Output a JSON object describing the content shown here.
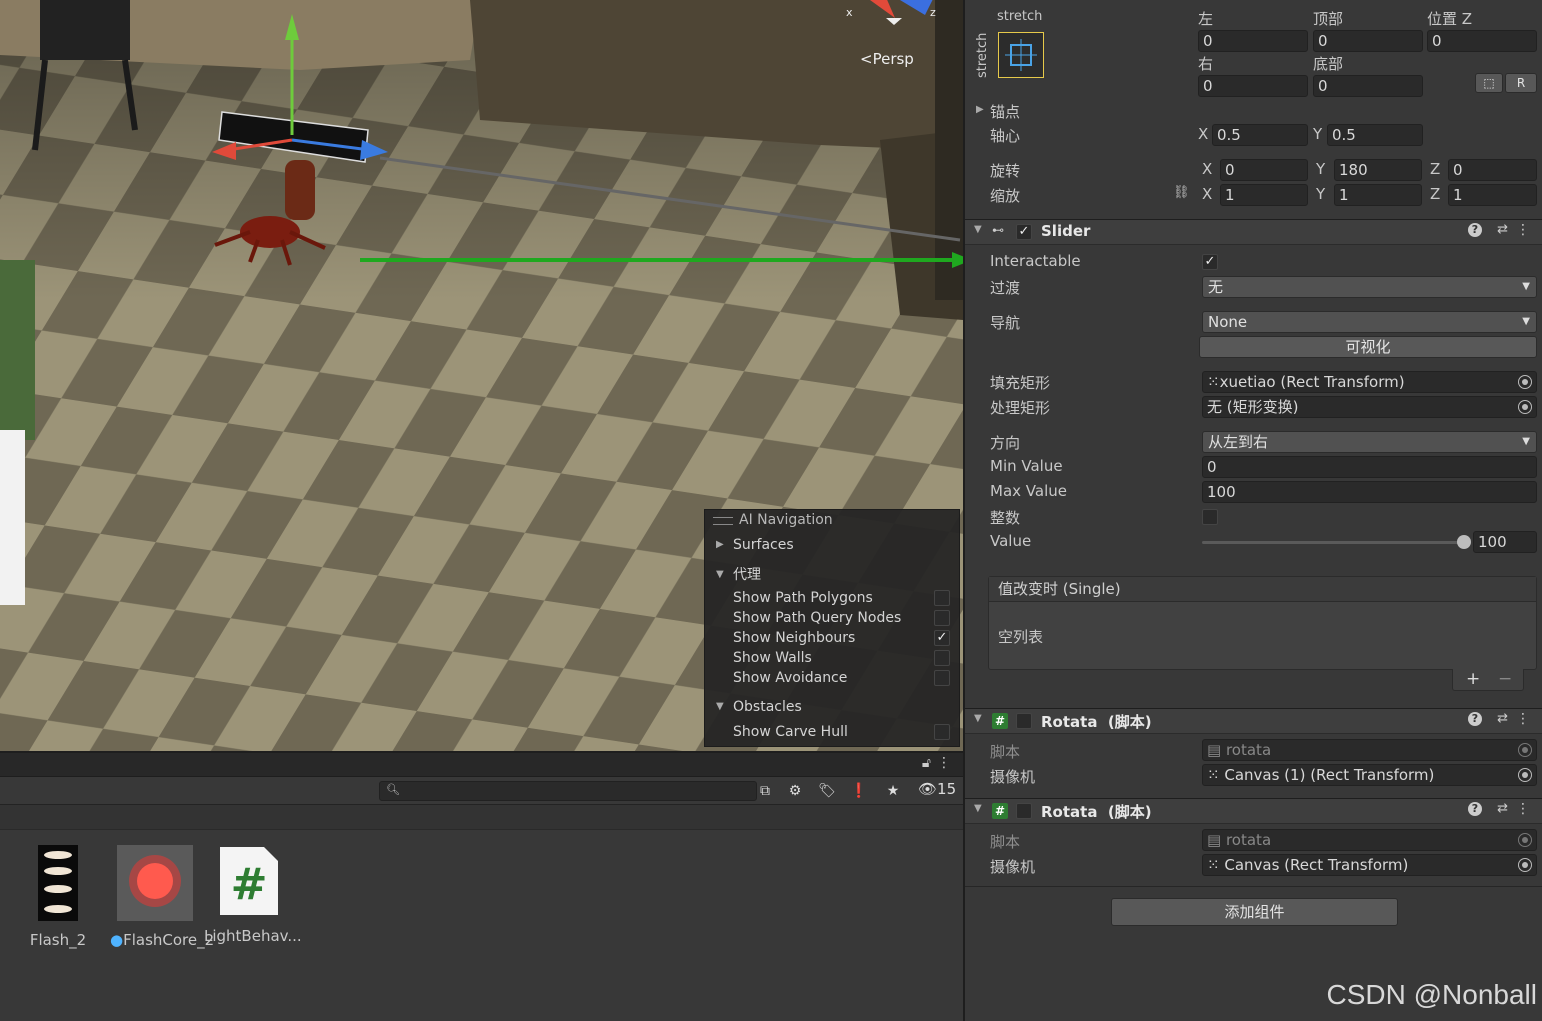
{
  "scene": {
    "camera_label": "Persp",
    "ai_navigation": {
      "title": "AI Navigation",
      "surfaces_label": "Surfaces",
      "agent_group_label": "代理",
      "options": [
        {
          "label": "Show Path Polygons",
          "checked": false
        },
        {
          "label": "Show Path Query Nodes",
          "checked": false
        },
        {
          "label": "Show Neighbours",
          "checked": true
        },
        {
          "label": "Show Walls",
          "checked": false
        },
        {
          "label": "Show Avoidance",
          "checked": false
        }
      ],
      "obstacles_label": "Obstacles",
      "carve_hull_label": "Show Carve Hull"
    }
  },
  "project": {
    "hidden_count": "15",
    "assets": [
      {
        "label": "Flash_2",
        "icon": "sprite-sheet-icon"
      },
      {
        "label": "FlashCore_2",
        "icon": "red-glow-texture-icon"
      },
      {
        "label": "LightBehav...",
        "icon": "csharp-script-icon"
      }
    ]
  },
  "inspector": {
    "rect": {
      "stretch_top": "stretch",
      "stretch_side": "stretch",
      "left_label": "左",
      "left_value": "0",
      "top_label": "顶部",
      "top_value": "0",
      "posz_label": "位置 Z",
      "posz_value": "0",
      "right_label": "右",
      "right_value": "0",
      "bottom_label": "底部",
      "bottom_value": "0",
      "raw_button": "R",
      "anchors_label": "锚点",
      "pivot_label": "轴心",
      "pivot_x": "0.5",
      "pivot_y": "0.5",
      "rotation_label": "旋转",
      "rot_x": "0",
      "rot_y": "180",
      "rot_z": "0",
      "scale_label": "缩放",
      "scale_x": "1",
      "scale_y": "1",
      "scale_z": "1",
      "x": "X",
      "y": "Y",
      "z": "Z"
    },
    "slider": {
      "title": "Slider",
      "interactable_label": "Interactable",
      "transition_label": "过渡",
      "transition_value": "无",
      "navigation_label": "导航",
      "navigation_value": "None",
      "visualize_button": "可视化",
      "fill_rect_label": "填充矩形",
      "fill_rect_value": "xuetiao (Rect Transform)",
      "handle_rect_label": "处理矩形",
      "handle_rect_value": "无 (矩形变换)",
      "direction_label": "方向",
      "direction_value": "从左到右",
      "min_label": "Min Value",
      "min_value": "0",
      "max_label": "Max Value",
      "max_value": "100",
      "whole_label": "整数",
      "value_label": "Value",
      "value": "100",
      "value_fraction": 1.0,
      "event_title": "值改变时 (Single)",
      "event_empty": "空列表",
      "plus": "+",
      "minus": "−"
    },
    "rotata1": {
      "title": "Rotata",
      "suffix": "(脚本)",
      "script_label": "脚本",
      "script_value": "rotata",
      "camera_label": "摄像机",
      "camera_value": "Canvas (1) (Rect Transform)"
    },
    "rotata2": {
      "title": "Rotata",
      "suffix": "(脚本)",
      "script_label": "脚本",
      "script_value": "rotata",
      "camera_label": "摄像机",
      "camera_value": "Canvas (Rect Transform)"
    },
    "add_component": "添加组件"
  },
  "watermark": "CSDN @Nonball"
}
